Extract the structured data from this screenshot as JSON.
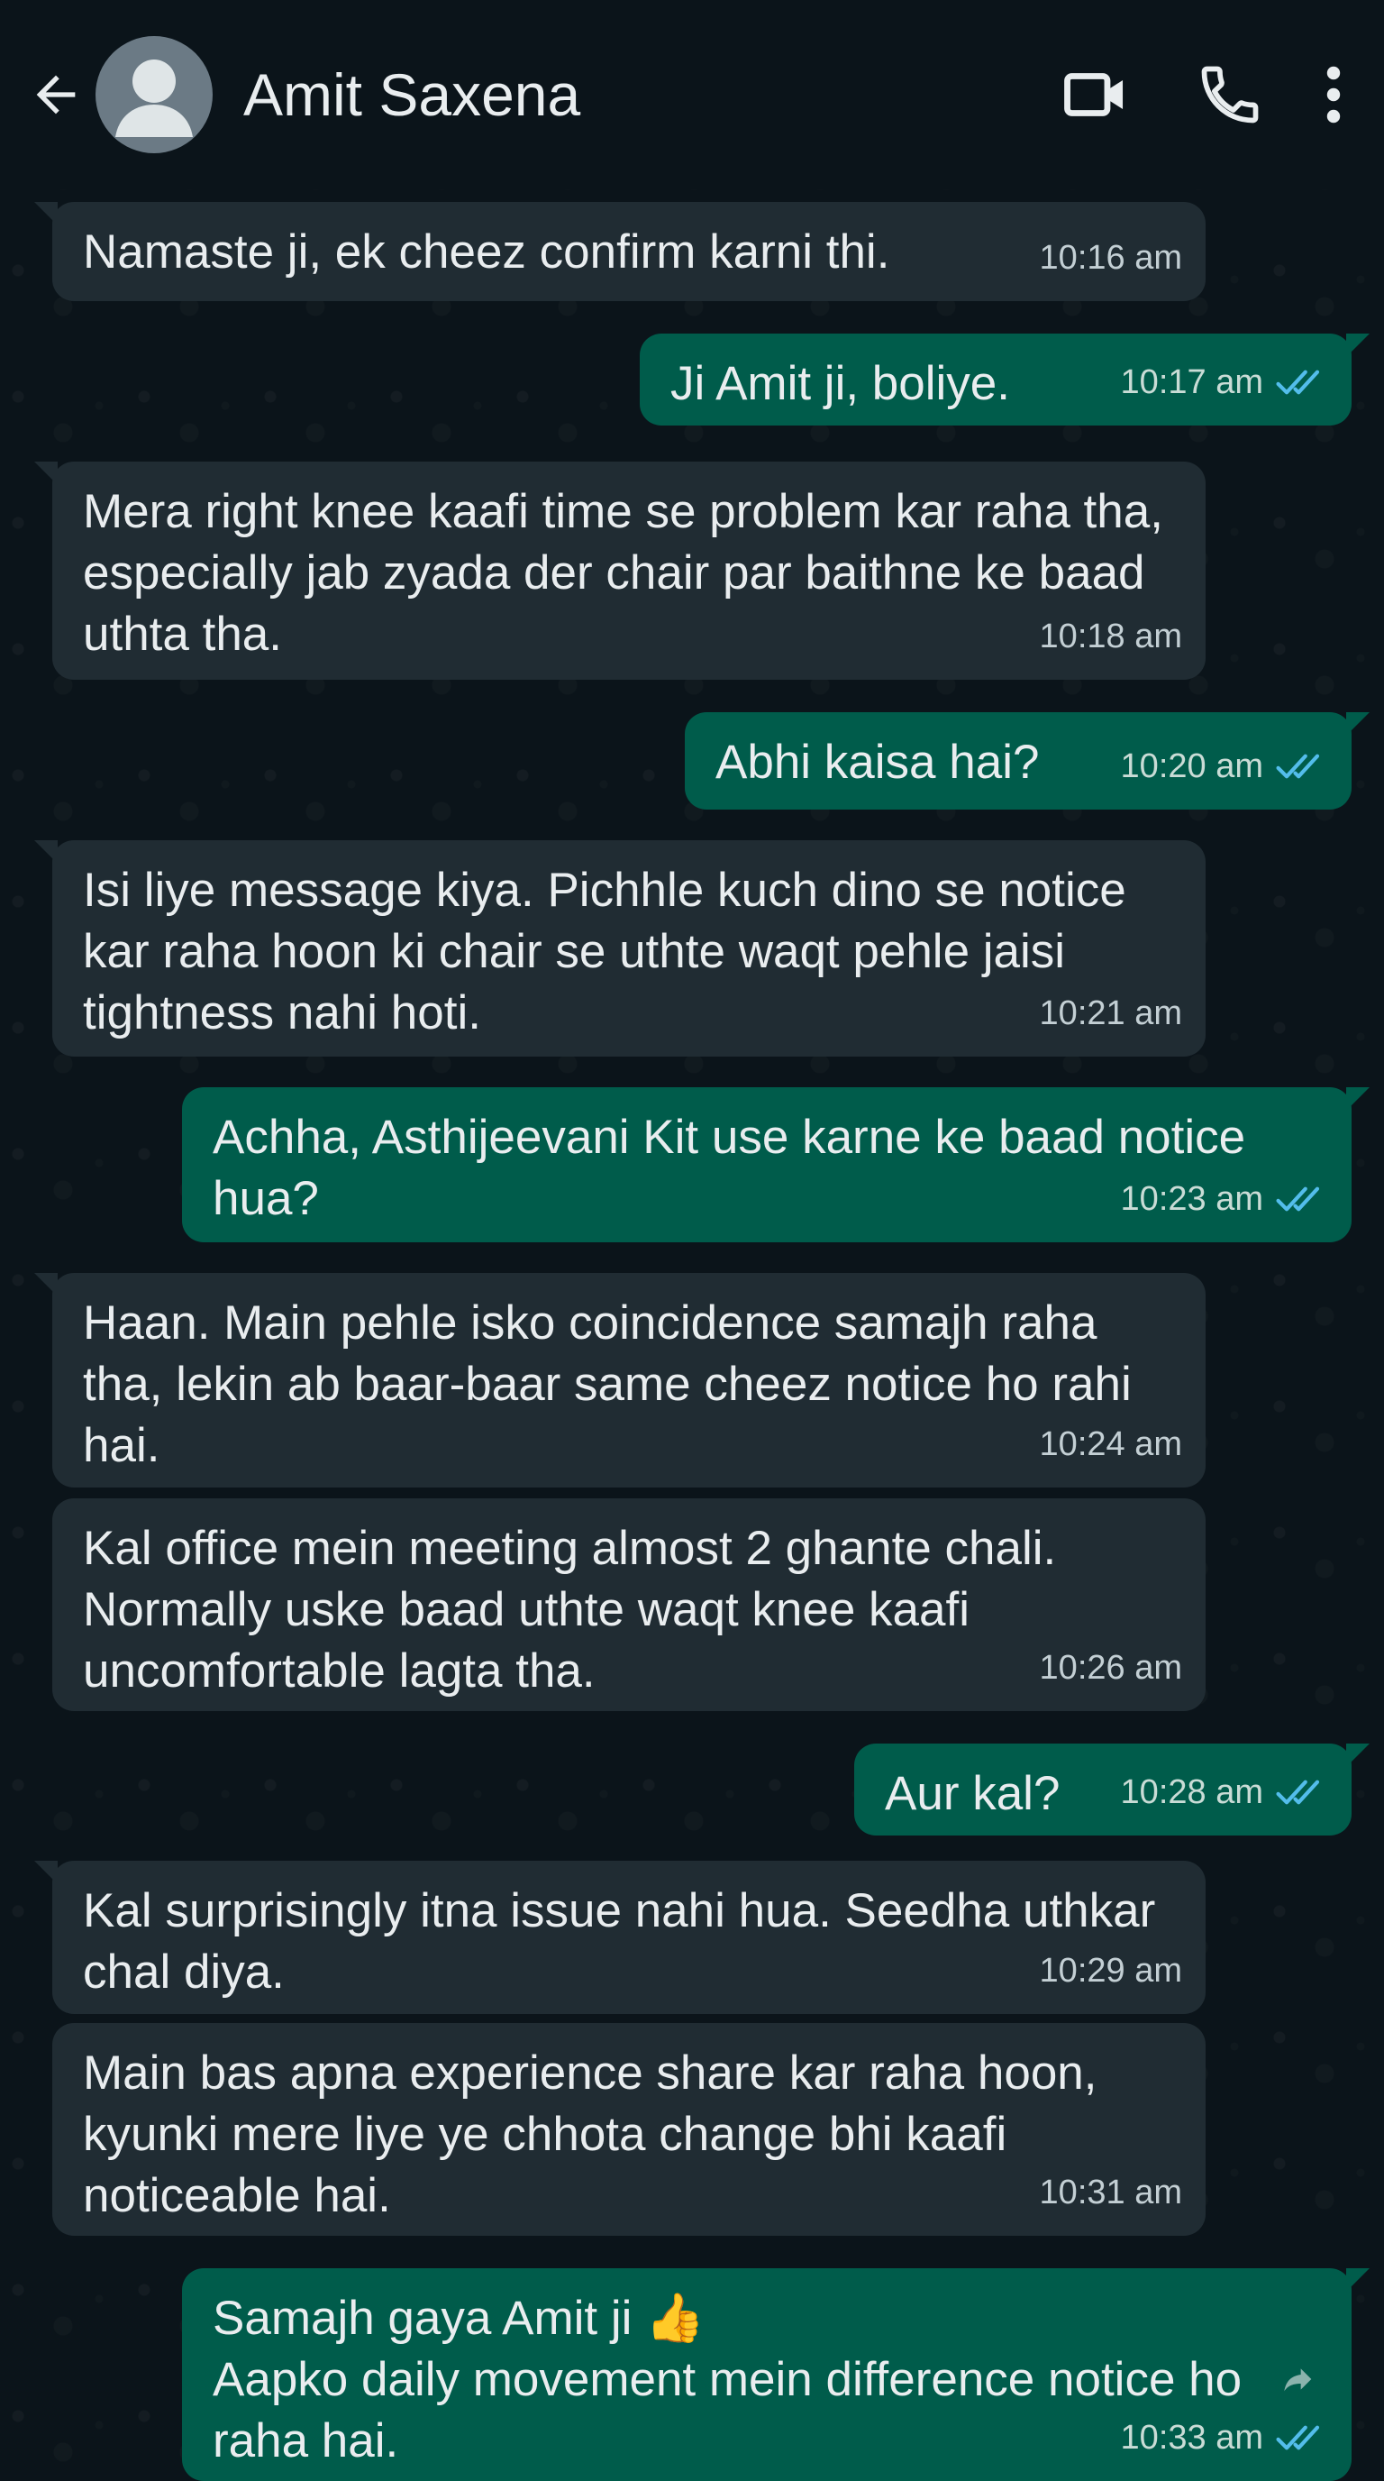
{
  "header": {
    "contact_name": "Amit Saxena"
  },
  "messages": [
    {
      "side": "in",
      "text": "Namaste ji, ek cheez confirm karni thi.",
      "time": "10:16 am"
    },
    {
      "side": "out",
      "text": "Ji Amit ji, boliye.",
      "time": "10:17 am",
      "status": "read"
    },
    {
      "side": "in",
      "text": "Mera right knee kaafi time se problem kar raha tha, especially jab zyada der chair par baithne ke baad uthta tha.",
      "time": "10:18 am"
    },
    {
      "side": "out",
      "text": "Abhi kaisa hai?",
      "time": "10:20 am",
      "status": "read"
    },
    {
      "side": "in",
      "text": "Isi liye message kiya. Pichhle kuch dino se notice kar raha hoon ki chair se uthte waqt pehle jaisi tightness nahi hoti.",
      "time": "10:21 am"
    },
    {
      "side": "out",
      "text": "Achha, Asthijeevani Kit use karne ke baad notice hua?",
      "time": "10:23 am",
      "status": "read"
    },
    {
      "side": "in",
      "text": "Haan. Main pehle isko coincidence samajh raha tha, lekin ab baar-baar same cheez notice ho rahi hai.",
      "time": "10:24 am"
    },
    {
      "side": "in",
      "text": "Kal office mein meeting almost 2 ghante chali. Normally uske baad uthte waqt knee kaafi uncomfortable lagta tha.",
      "time": "10:26 am"
    },
    {
      "side": "out",
      "text": "Aur kal?",
      "time": "10:28 am",
      "status": "read"
    },
    {
      "side": "in",
      "text": "Kal surprisingly itna issue nahi hua. Seedha uthkar chal diya.",
      "time": "10:29 am"
    },
    {
      "side": "in",
      "text": "Main bas apna experience share kar raha hoon, kyunki mere liye ye chhota change bhi kaafi noticeable hai.",
      "time": "10:31 am"
    },
    {
      "side": "out",
      "text": "Samajh gaya Amit ji 👍\nAapko daily movement mein difference notice ho raha hai.",
      "time": "10:33 am",
      "status": "read"
    }
  ],
  "colors": {
    "incoming_bubble": "#202c33",
    "outgoing_bubble": "#005c4b",
    "read_ticks": "#53bdeb",
    "background": "#0b141a"
  },
  "icons": {
    "back": "arrow-left-icon",
    "avatar": "default-user-icon",
    "video": "video-camera-icon",
    "call": "phone-icon",
    "menu": "more-vertical-icon",
    "read": "double-check-icon",
    "forward": "forward-arrow-icon"
  }
}
